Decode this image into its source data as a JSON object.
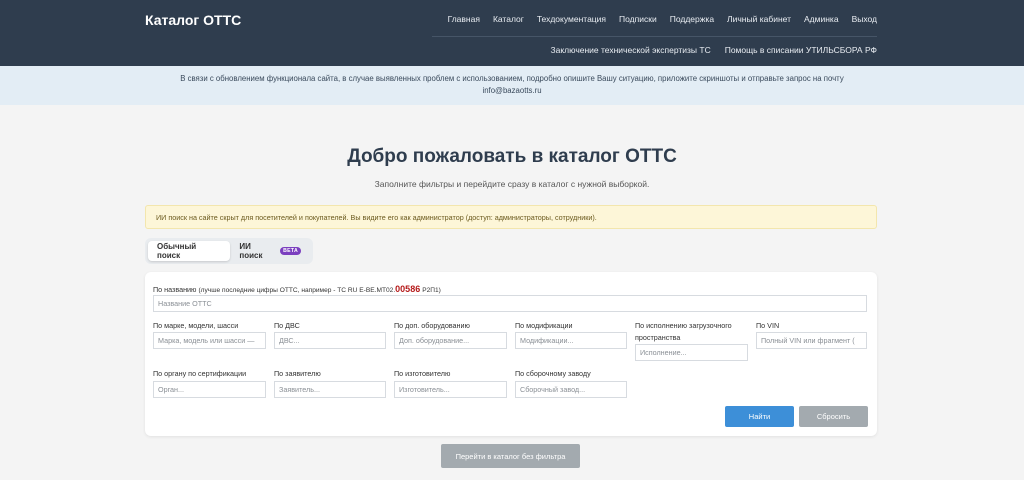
{
  "navbar": {
    "brand": "Каталог ОТТС",
    "main_links": [
      "Главная",
      "Каталог",
      "Техдокументация",
      "Подписки",
      "Поддержка",
      "Личный кабинет",
      "Админка",
      "Выход"
    ],
    "sub_links": [
      "Заключение технической экспертизы ТС",
      "Помощь в списании УТИЛЬСБОРА РФ"
    ]
  },
  "notice": {
    "line1": "В связи с обновлением функционала сайта, в случае выявленных проблем с использованием, подробно опишите Вашу ситуацию, приложите скриншоты и отправьте запрос на почту",
    "line2": "info@bazaotts.ru"
  },
  "hero": {
    "title": "Добро пожаловать в каталог ОТТС",
    "subtitle": "Заполните фильтры и перейдите сразу в каталог с нужной выборкой."
  },
  "admin_alert": "ИИ поиск на сайте скрыт для посетителей и покупателей. Вы видите его как администратор (доступ: администраторы, сотрудники).",
  "tabs": {
    "regular": "Обычный поиск",
    "ai": "ИИ поиск",
    "ai_badge": "BETA"
  },
  "form": {
    "name": {
      "label_prefix": "По названию",
      "label_hint": "(лучше последние цифры ОТТС, например - ТС RU E-BE.МТ02.",
      "label_highlight": "00586",
      "label_suffix": "Р2П1)",
      "placeholder": "Название ОТТС"
    },
    "brand": {
      "label": "По марке, модели, шасси",
      "placeholder": "Марка, модель или шасси —"
    },
    "engine": {
      "label": "По ДВС",
      "placeholder": "ДВС..."
    },
    "equipment": {
      "label": "По доп. оборудованию",
      "placeholder": "Доп. оборудование..."
    },
    "modification": {
      "label": "По модификации",
      "placeholder": "Модификации..."
    },
    "cargo": {
      "label_line1": "По исполнению загрузочного",
      "label_line2": "пространства",
      "placeholder": "Исполнение..."
    },
    "vin": {
      "label": "По VIN",
      "placeholder": "Полный VIN или фрагмент ("
    },
    "cert_body": {
      "label": "По органу по сертификации",
      "placeholder": "Орган..."
    },
    "applicant": {
      "label": "По заявителю",
      "placeholder": "Заявитель..."
    },
    "manufacturer": {
      "label": "По изготовителю",
      "placeholder": "Изготовитель..."
    },
    "plant": {
      "label": "По сборочному заводу",
      "placeholder": "Сборочный завод..."
    },
    "find_button": "Найти",
    "reset_button": "Сбросить"
  },
  "catalog_button": "Перейти в каталог без фильтра",
  "colors": {
    "navbar": "#2f3d4e",
    "primary": "#3d8fd8",
    "secondary": "#a3aaaf",
    "badge": "#7b3fbf",
    "highlight": "#b51a1a"
  }
}
